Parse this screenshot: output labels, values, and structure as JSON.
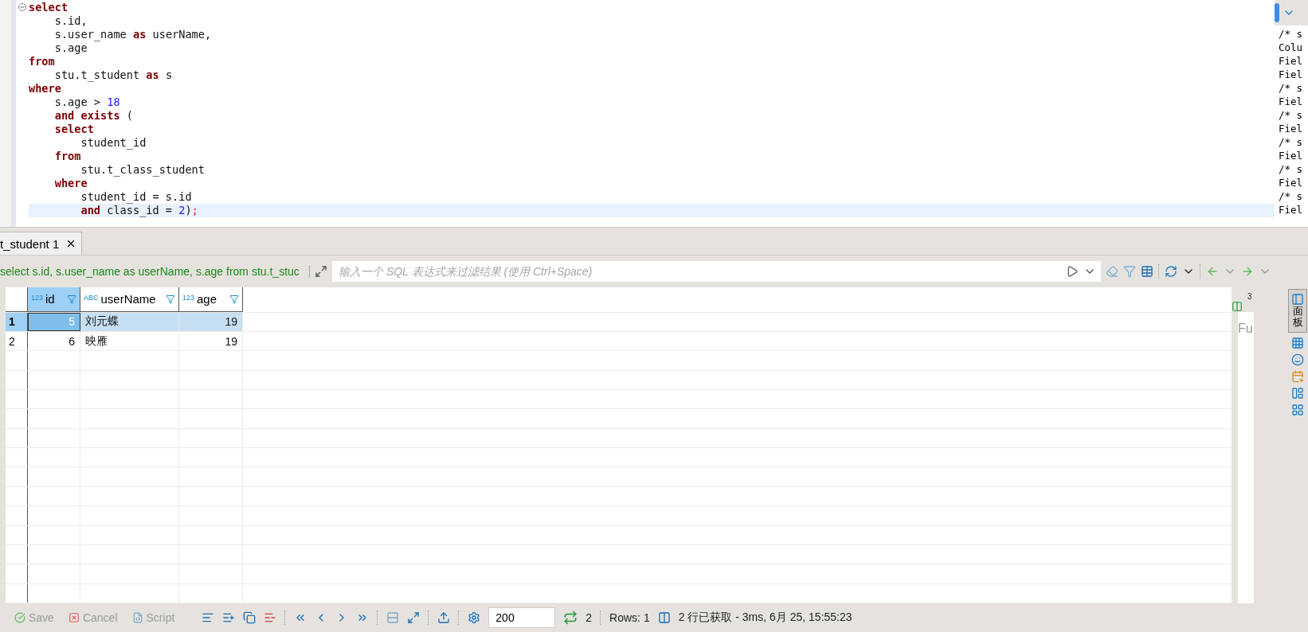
{
  "editor": {
    "lines": [
      {
        "current": false,
        "tokens": [
          {
            "kind": "keyword",
            "text": "select"
          }
        ]
      },
      {
        "current": false,
        "tokens": [
          {
            "kind": "plain",
            "text": "    s.id,"
          }
        ]
      },
      {
        "current": false,
        "tokens": [
          {
            "kind": "plain",
            "text": "    s.user_name "
          },
          {
            "kind": "keyword",
            "text": "as"
          },
          {
            "kind": "plain",
            "text": " userName,"
          }
        ]
      },
      {
        "current": false,
        "tokens": [
          {
            "kind": "plain",
            "text": "    s.age"
          }
        ]
      },
      {
        "current": false,
        "tokens": [
          {
            "kind": "keyword",
            "text": "from"
          }
        ]
      },
      {
        "current": false,
        "tokens": [
          {
            "kind": "plain",
            "text": "    stu.t_student "
          },
          {
            "kind": "keyword",
            "text": "as"
          },
          {
            "kind": "plain",
            "text": " s"
          }
        ]
      },
      {
        "current": false,
        "tokens": [
          {
            "kind": "keyword",
            "text": "where"
          }
        ]
      },
      {
        "current": false,
        "tokens": [
          {
            "kind": "plain",
            "text": "    s.age > "
          },
          {
            "kind": "number",
            "text": "18"
          }
        ]
      },
      {
        "current": false,
        "tokens": [
          {
            "kind": "keyword",
            "text": "    and exists"
          },
          {
            "kind": "plain",
            "text": " ("
          }
        ]
      },
      {
        "current": false,
        "tokens": [
          {
            "kind": "keyword",
            "text": "    select"
          }
        ]
      },
      {
        "current": false,
        "tokens": [
          {
            "kind": "plain",
            "text": "        student_id"
          }
        ]
      },
      {
        "current": false,
        "tokens": [
          {
            "kind": "keyword",
            "text": "    from"
          }
        ]
      },
      {
        "current": false,
        "tokens": [
          {
            "kind": "plain",
            "text": "        stu.t_class_student"
          }
        ]
      },
      {
        "current": false,
        "tokens": [
          {
            "kind": "keyword",
            "text": "    where"
          }
        ]
      },
      {
        "current": false,
        "tokens": [
          {
            "kind": "plain",
            "text": "        student_id = s.id"
          }
        ]
      },
      {
        "current": true,
        "tokens": [
          {
            "kind": "keyword",
            "text": "        and"
          },
          {
            "kind": "plain",
            "text": " class_id = "
          },
          {
            "kind": "number",
            "text": "2"
          },
          {
            "kind": "plain",
            "text": ")"
          },
          {
            "kind": "punct",
            "text": ";"
          }
        ]
      }
    ]
  },
  "log_panel": {
    "lines": [
      "/* s",
      "Colu",
      "Fiel",
      "Fiel",
      "/* s",
      "Fiel",
      "/* s",
      "Fiel",
      "/* s",
      "Fiel",
      "/* s",
      "Fiel",
      "/* s",
      "Fiel"
    ]
  },
  "results_tab": {
    "label": "t_student 1",
    "selected": true
  },
  "filter": {
    "query": "select s.id, s.user_name as userName, s.age from stu.t_stuc",
    "placeholder": "输入一个 SQL 表达式来过滤结果 (使用 Ctrl+Space)"
  },
  "table": {
    "columns": [
      {
        "type_badge": "123",
        "name": "id",
        "selected": true
      },
      {
        "type_badge": "ABC",
        "name": "userName",
        "selected": false
      },
      {
        "type_badge": "123",
        "name": "age",
        "selected": false
      }
    ],
    "rows": [
      {
        "number": "1",
        "selected": true,
        "cells": [
          "5",
          "刘元蝶",
          "19"
        ]
      },
      {
        "number": "2",
        "selected": false,
        "cells": [
          "6",
          "映雁",
          "19"
        ]
      }
    ]
  },
  "side_panel": {
    "count": "3",
    "text": "Fu"
  },
  "side_tabs": [
    {
      "label": "面板",
      "selected": true
    }
  ],
  "status_bar": {
    "buttons": [
      {
        "label": "Save",
        "disabled": true
      },
      {
        "label": "Cancel",
        "disabled": true
      },
      {
        "label": "Script",
        "disabled": true
      }
    ],
    "fetch_size": "200",
    "refresh_count": "2",
    "rows": "Rows: 1",
    "message": "2 行已获取 - 3ms, 6月 25, 15:55:23"
  }
}
